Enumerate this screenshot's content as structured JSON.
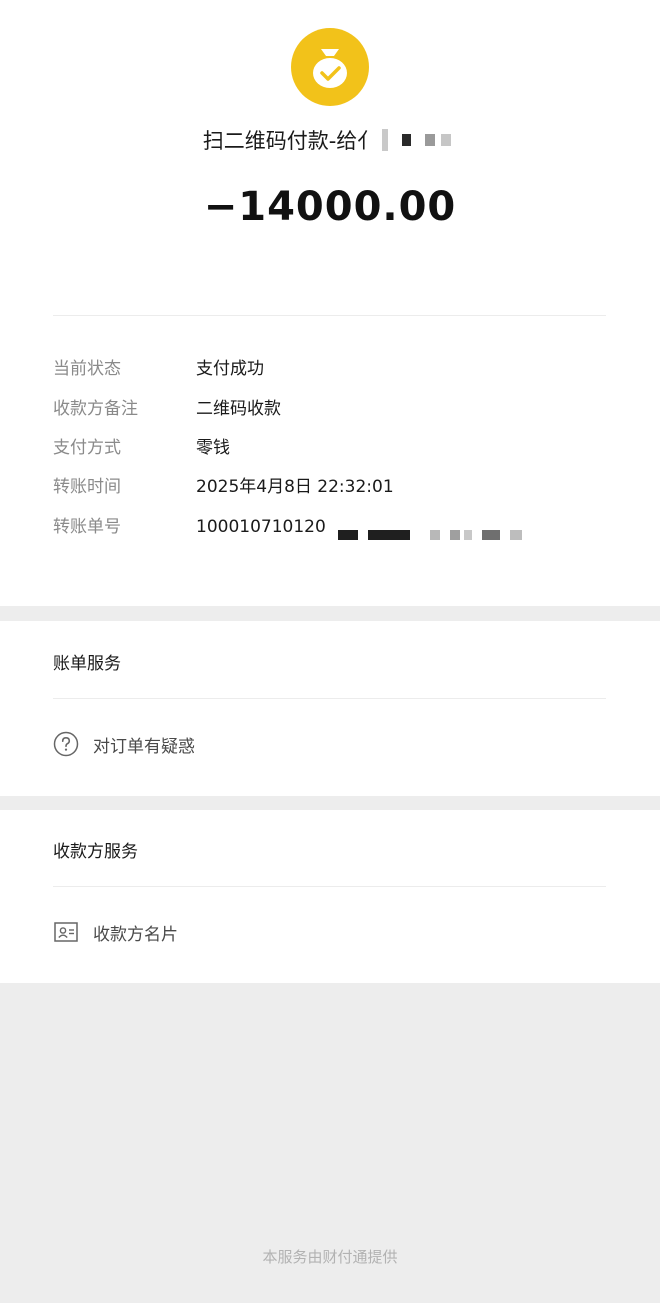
{
  "header": {
    "logo_icon": "money-bag-check-icon",
    "logo_color": "#f2c21a",
    "merchant_title": "扫二维码付款-给亻",
    "amount": "−14000.00"
  },
  "details": [
    {
      "label": "当前状态",
      "value": "支付成功"
    },
    {
      "label": "收款方备注",
      "value": "二维码收款"
    },
    {
      "label": "支付方式",
      "value": "零钱"
    },
    {
      "label": "转账时间",
      "value": "2025年4月8日 22:32:01"
    },
    {
      "label": "转账单号",
      "value": "100010710120"
    }
  ],
  "bill_service": {
    "title": "账单服务",
    "item_icon": "question-circle-icon",
    "item_label": "对订单有疑惑"
  },
  "payee_service": {
    "title": "收款方服务",
    "item_icon": "contact-card-icon",
    "item_label": "收款方名片"
  },
  "footer": {
    "text": "本服务由财付通提供"
  }
}
